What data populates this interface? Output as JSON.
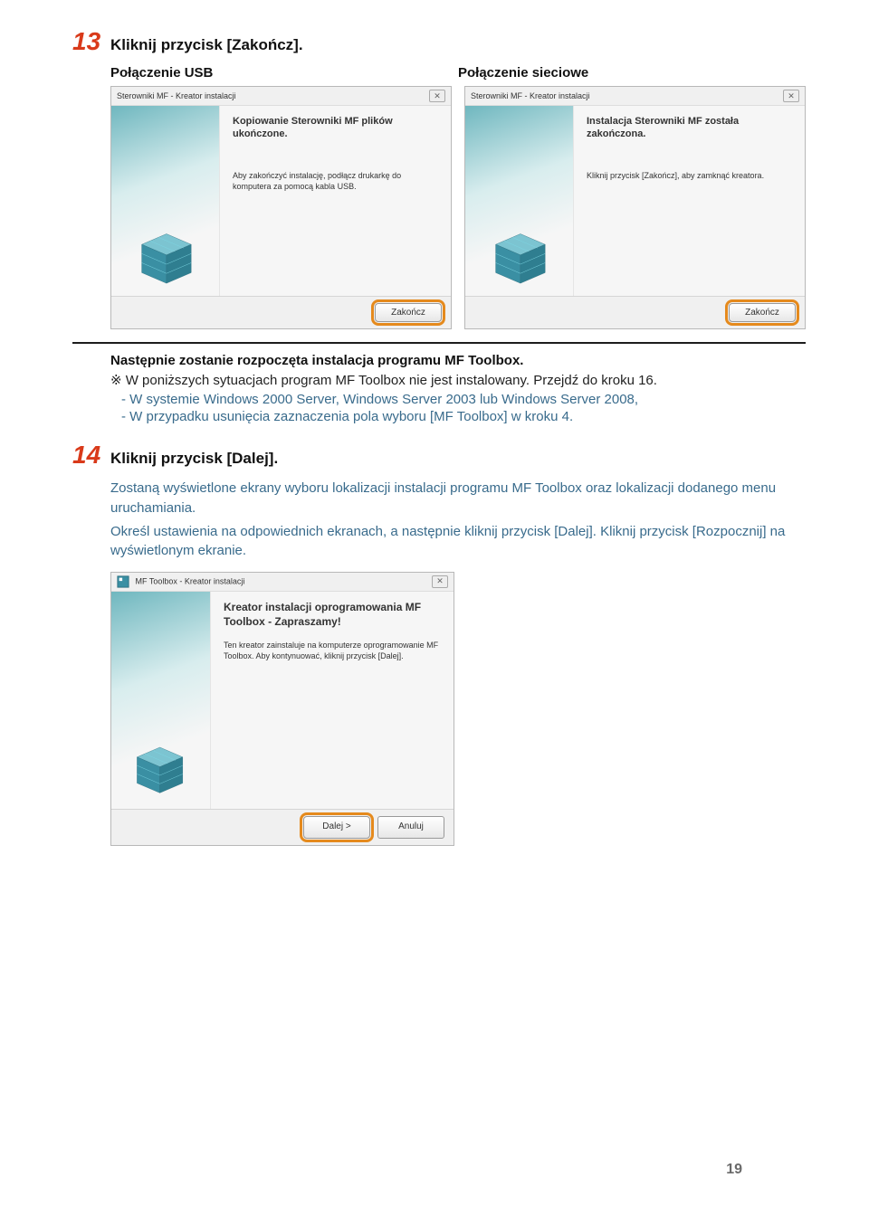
{
  "step13": {
    "number": "13",
    "title": "Kliknij przycisk [Zakończ].",
    "usb_label": "Połączenie USB",
    "net_label": "Połączenie sieciowe"
  },
  "dlg_usb": {
    "window_title": "Sterowniki MF - Kreator instalacji",
    "heading": "Kopiowanie Sterowniki MF plików ukończone.",
    "line1": "Aby zakończyć instalację, podłącz drukarkę do komputera za pomocą kabla USB.",
    "btn_finish": "Zakończ"
  },
  "dlg_net": {
    "window_title": "Sterowniki MF - Kreator instalacji",
    "heading": "Instalacja Sterowniki MF została zakończona.",
    "line1": "Kliknij przycisk [Zakończ], aby zamknąć kreatora.",
    "btn_finish": "Zakończ"
  },
  "after13": {
    "line_main": "Następnie zostanie rozpoczęta instalacja programu MF Toolbox.",
    "line_sub": "※ W poniższych sytuacjach program MF Toolbox nie jest instalowany. Przejdź do kroku 16.",
    "bullet1": "- W systemie Windows 2000 Server, Windows Server 2003 lub Windows Server 2008,",
    "bullet2": "- W przypadku usunięcia zaznaczenia pola wyboru [MF Toolbox] w kroku 4."
  },
  "step14": {
    "number": "14",
    "title": "Kliknij przycisk [Dalej].",
    "para1": "Zostaną wyświetlone ekrany wyboru lokalizacji instalacji programu MF Toolbox oraz lokalizacji dodanego menu uruchamiania.",
    "para2": "Określ ustawienia na odpowiednich ekranach, a następnie kliknij przycisk [Dalej]. Kliknij przycisk [Rozpocznij] na wyświetlonym ekranie."
  },
  "dlg_toolbox": {
    "window_title": "MF Toolbox - Kreator instalacji",
    "heading": "Kreator instalacji oprogramowania MF Toolbox - Zapraszamy!",
    "line1": "Ten kreator zainstaluje na komputerze oprogramowanie MF Toolbox. Aby kontynuować, kliknij przycisk [Dalej].",
    "btn_next": "Dalej >",
    "btn_cancel": "Anuluj"
  },
  "page_number": "19"
}
